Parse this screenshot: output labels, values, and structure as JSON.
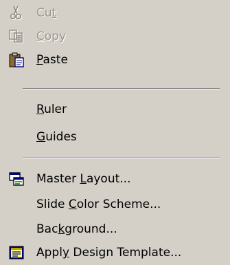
{
  "menu": {
    "items": [
      {
        "id": "cut",
        "label": "Cut",
        "mnemonic": "t",
        "enabled": false,
        "icon": "scissors-icon"
      },
      {
        "id": "copy",
        "label": "Copy",
        "mnemonic": "C",
        "enabled": false,
        "icon": "copy-icon"
      },
      {
        "id": "paste",
        "label": "Paste",
        "mnemonic": "P",
        "enabled": true,
        "icon": "clipboard-paste-icon"
      },
      {
        "id": "ruler",
        "label": "Ruler",
        "mnemonic": "R",
        "enabled": true,
        "icon": ""
      },
      {
        "id": "guides",
        "label": "Guides",
        "mnemonic": "G",
        "enabled": true,
        "icon": ""
      },
      {
        "id": "master_layout",
        "label": "Master Layout...",
        "mnemonic": "L",
        "enabled": true,
        "icon": "master-layout-icon"
      },
      {
        "id": "slide_color_scheme",
        "label": "Slide Color Scheme...",
        "mnemonic": "C",
        "enabled": true,
        "icon": ""
      },
      {
        "id": "background",
        "label": "Background...",
        "mnemonic": "k",
        "enabled": true,
        "icon": ""
      },
      {
        "id": "apply_design_template",
        "label": "Apply Design Template...",
        "mnemonic": "y",
        "enabled": true,
        "icon": "design-template-icon"
      }
    ]
  },
  "colors": {
    "menu_background": "#d4d0c8",
    "disabled_text": "#9a968e",
    "text": "#000000"
  }
}
